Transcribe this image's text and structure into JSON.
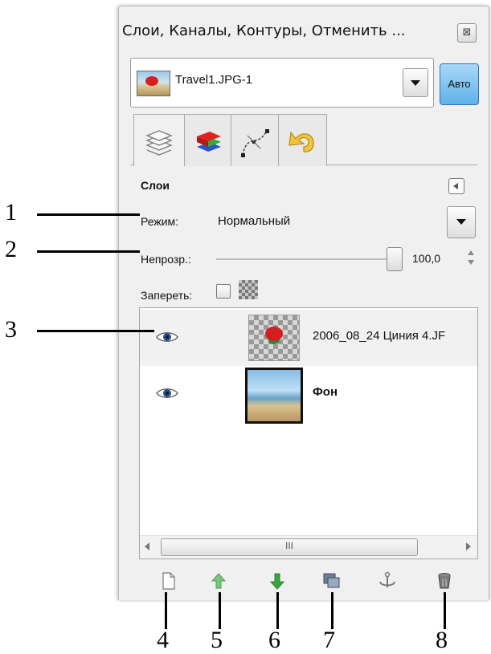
{
  "dock": {
    "title": "Слои, Каналы, Контуры, Отменить ...",
    "close_glyph": "⊠"
  },
  "image_selector": {
    "name": "Travel1.JPG-1",
    "auto_label": "Авто"
  },
  "tabs": [
    {
      "id": "layers",
      "icon": "layers-icon",
      "active": true
    },
    {
      "id": "channels",
      "icon": "channels-icon",
      "active": false
    },
    {
      "id": "paths",
      "icon": "paths-icon",
      "active": false
    },
    {
      "id": "undo",
      "icon": "undo-history-icon",
      "active": false
    }
  ],
  "layers_panel": {
    "title": "Слои",
    "mode_label": "Режим:",
    "mode_value": "Нормальный",
    "opacity_label": "Непрозр.:",
    "opacity_value": "100,0",
    "opacity_level_percent": 100,
    "lock_label": "Запереть:",
    "lock_checked": false,
    "scroll_grip": "III"
  },
  "layers": [
    {
      "name": "2006_08_24 Циния 4.JF",
      "visible": true,
      "selected": true,
      "bold": false
    },
    {
      "name": "Фон",
      "visible": true,
      "selected": false,
      "bold": true
    }
  ],
  "toolbar": [
    {
      "id": "new",
      "icon": "new-layer-icon"
    },
    {
      "id": "raise",
      "icon": "raise-layer-icon",
      "color": "#6fbf6f"
    },
    {
      "id": "lower",
      "icon": "lower-layer-icon",
      "color": "#3aa53a"
    },
    {
      "id": "duplicate",
      "icon": "duplicate-layer-icon"
    },
    {
      "id": "anchor",
      "icon": "anchor-layer-icon"
    },
    {
      "id": "delete",
      "icon": "delete-layer-icon"
    }
  ],
  "callouts": [
    "1",
    "2",
    "3",
    "4",
    "5",
    "6",
    "7",
    "8"
  ],
  "colors": {
    "auto_button": "#5fb2ea",
    "selected_row": "#f1f1f1",
    "panel_bg": "#f0f0f0"
  }
}
